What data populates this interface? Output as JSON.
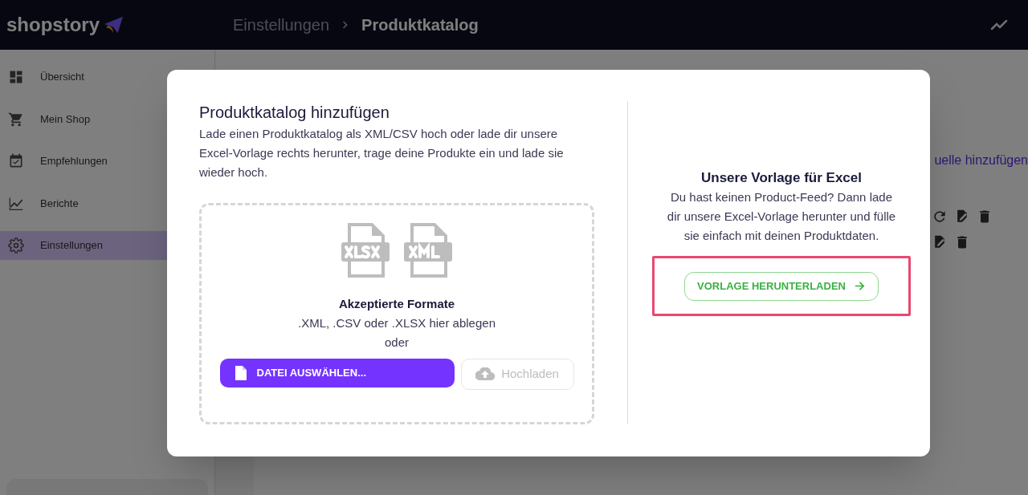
{
  "header": {
    "logo": "shopstory",
    "breadcrumb": [
      {
        "label": "Einstellungen",
        "current": false
      },
      {
        "label": "Produktkatalog",
        "current": true
      }
    ]
  },
  "sidebar": {
    "items": [
      {
        "label": "Übersicht",
        "selected": false
      },
      {
        "label": "Mein Shop",
        "selected": false
      },
      {
        "label": "Empfehlungen",
        "selected": false
      },
      {
        "label": "Berichte",
        "selected": false
      },
      {
        "label": "Einstellungen",
        "selected": true
      }
    ]
  },
  "background_link": "uelle hinzufügen",
  "dialog": {
    "title": "Produktkatalog hinzufügen",
    "description": "Lade einen Produktkatalog als XML/CSV hoch oder lade dir unsere Excel-Vorlage rechts herunter, trage deine Produkte ein und lade sie wieder hoch.",
    "dropzone": {
      "heading": "Akzeptierte Formate",
      "hint": ".XML, .CSV oder .XLSX hier ablegen",
      "or": "oder",
      "choose_button": "DATEI AUSWÄHLEN...",
      "upload_button": {
        "label": "Hochladen",
        "disabled": true
      }
    },
    "template": {
      "title": "Unsere Vorlage für Excel",
      "text": "Du hast keinen Product-Feed? Dann lade dir unsere Excel-Vorlage herunter und fülle sie einfach mit deinen Produktdaten.",
      "button": "VORLAGE HERUNTERLADEN",
      "highlighted": true
    }
  }
}
